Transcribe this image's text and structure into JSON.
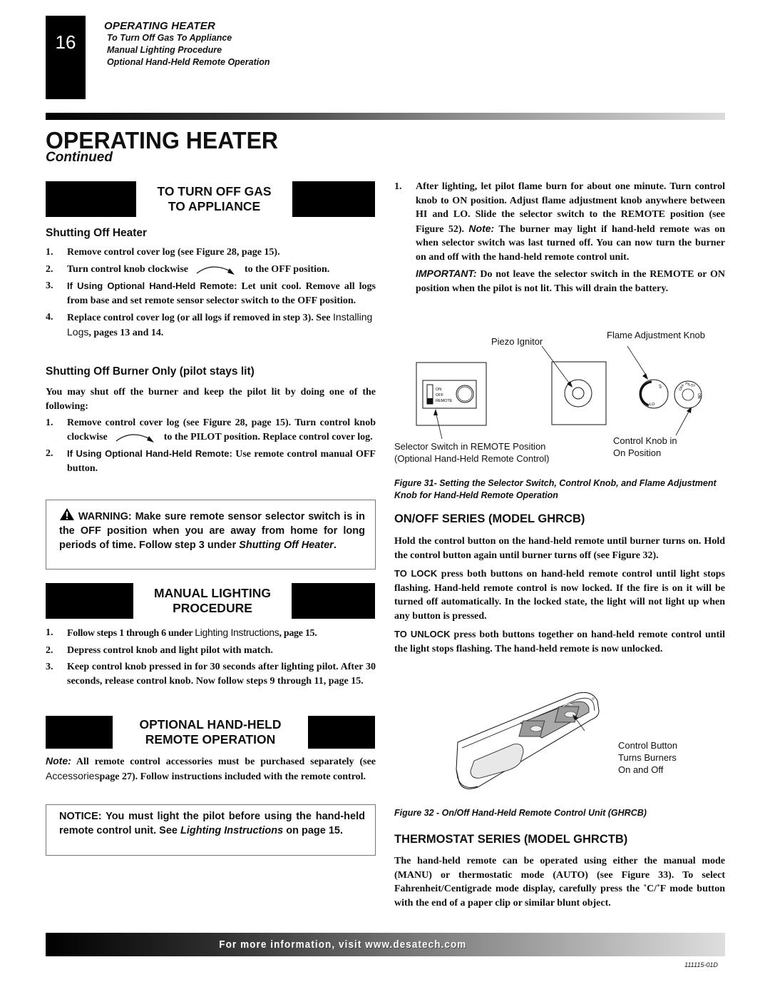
{
  "header": {
    "page_number": "16",
    "section": "OPERATING HEATER",
    "toc_items": [
      "To Turn Off Gas To Appliance",
      "Manual Lighting Procedure",
      "Optional Hand-Held Remote Operation"
    ]
  },
  "title": {
    "main": "OPERATING HEATER",
    "continued": "Continued"
  },
  "left": {
    "turn_off": {
      "header_line1": "TO TURN OFF GAS",
      "header_line2": "TO APPLIANCE",
      "shutting_off_heater": {
        "title": "Shutting Off Heater",
        "steps": [
          {
            "n": "1.",
            "text": "Remove control cover log (see Figure 28, page 15)."
          },
          {
            "n": "2.",
            "pre": "Turn control knob clockwise",
            "post": "to the OFF position."
          },
          {
            "n": "3.",
            "lead": "If Using Optional Hand-Held Remote:",
            "text": " Let unit cool. Remove all logs from base and set remote sensor selector switch to the OFF position."
          },
          {
            "n": "4.",
            "text": "Replace control cover log (or all logs if removed in step 3). See ",
            "ref": "Installing Logs",
            "post": ", pages 13 and 14."
          }
        ]
      },
      "burner_only": {
        "title": "Shutting Off Burner Only (pilot stays lit)",
        "intro": "You may shut off the burner and keep the pilot lit by doing one of the following:",
        "steps": [
          {
            "n": "1.",
            "pre": "Remove control cover log (see Figure 28, page 15). Turn control knob clockwise",
            "post": "to the PILOT position. Replace control cover log."
          },
          {
            "n": "2.",
            "lead": "If Using Optional Hand-Held Remote:",
            "text": " Use remote control manual OFF button."
          }
        ]
      },
      "warning": {
        "label": "WARNING:",
        "text": " Make sure remote sensor selector switch is in the OFF position when you are away from home for long periods of time. Follow step 3 under ",
        "ref": "Shutting Off Heater",
        "post": "."
      }
    },
    "manual_lighting": {
      "header_line1": "MANUAL LIGHTING",
      "header_line2": "PROCEDURE",
      "steps": [
        {
          "n": "1.",
          "pre": "Follow steps 1 through 6 under ",
          "ref": "Lighting Instructions",
          "post": ", page 15."
        },
        {
          "n": "2.",
          "text": "Depress control knob and light pilot with match."
        },
        {
          "n": "3.",
          "text": "Keep control knob pressed in for 30 seconds after lighting pilot. After 30 seconds, release control knob. Now follow steps 9 through 11, page 15."
        }
      ]
    },
    "remote_op": {
      "header_line1": "OPTIONAL HAND-HELD",
      "header_line2": "REMOTE OPERATION",
      "note_label": "Note:",
      "note_pre": " All remote control accessories must be purchased separately (see ",
      "note_ref": "Accessories",
      "note_post": "page 27). Follow instructions included with the remote control.",
      "notice": {
        "pre": "NOTICE: You must light the pilot before using the hand-held remote control unit. See ",
        "ref": "Lighting Instructions",
        "post": " on page 15."
      }
    }
  },
  "right": {
    "step1": {
      "n": "1.",
      "text": "After lighting, let pilot flame burn for about one minute. Turn control knob to ON position. Adjust flame adjustment knob anywhere between HI and LO. Slide the selector switch to the REMOTE position (see Figure 52). ",
      "note_label": "Note:",
      "note_text": " The burner may light if hand-held remote was on when selector switch was last turned off. You can now turn the burner on and off with the hand-held remote control unit.",
      "important_label": "IMPORTANT:",
      "important_text": " Do not leave the selector switch in the REMOTE or ON position when the pilot is not lit. This will drain the battery."
    },
    "figure31": {
      "label_piezo": "Piezo Ignitor",
      "label_flame": "Flame Adjustment Knob",
      "label_selector_1": "Selector Switch in REMOTE Position",
      "label_selector_2": "(Optional Hand-Held Remote Control)",
      "label_control_1": "Control Knob in",
      "label_control_2": "On Position",
      "switch_on": "ON",
      "switch_off": "OFF",
      "switch_remote": "REMOTE",
      "knob_hi": "HI",
      "knob_lo": "LO",
      "knob_off": "OFF",
      "knob_pilot": "PILOT",
      "knob_on": "ON",
      "caption": "Figure 31- Setting the Selector Switch, Control Knob, and Flame Adjustment Knob for Hand-Held Remote Operation"
    },
    "onoff": {
      "title": "ON/OFF SERIES (MODEL GHRCB)",
      "p1": "Hold the control button on the hand-held remote until burner turns on. Hold the control button again until burner turns off (see Figure 32).",
      "lock_label": "TO LOCK",
      "lock_text": " press both buttons on hand-held remote control until light stops flashing. Hand-held remote control is now locked. If the fire is on it will be turned off automatically. In the locked state, the light will not light up when any button is pressed.",
      "unlock_label": "TO UNLOCK",
      "unlock_text": " press both buttons together on hand-held remote control until the light stops flashing. The hand-held remote is now unlocked."
    },
    "figure32": {
      "label_1": "Control Button",
      "label_2": "Turns Burners",
      "label_3": "On and Off",
      "caption": "Figure 32 - On/Off Hand-Held Remote Control Unit (GHRCB)"
    },
    "thermostat": {
      "title": "THERMOSTAT SERIES (MODEL GHRCTB)",
      "text": "The hand-held remote can be operated using either the manual mode (MANU) or thermostatic mode (AUTO) (see Figure 33). To select Fahrenheit/Centigrade mode display, carefully press the ˚C/˚F mode button with the end of a paper clip or similar blunt object."
    }
  },
  "footer": {
    "text": "For more information, visit www.desatech.com",
    "doc_number": "111115-01D"
  }
}
